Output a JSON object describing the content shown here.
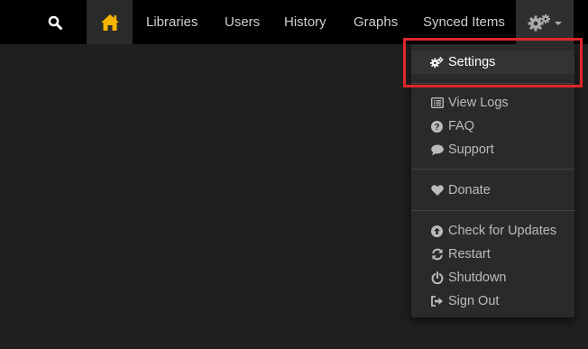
{
  "nav": {
    "search_icon": "search-icon",
    "home_icon": "home-icon",
    "links": [
      "Libraries",
      "Users",
      "History",
      "Graphs",
      "Synced Items"
    ],
    "settings_icon": "cogs-icon",
    "home_color": "#f5b400"
  },
  "menu": {
    "settings": "Settings",
    "view_logs": "View Logs",
    "faq": "FAQ",
    "support": "Support",
    "donate": "Donate",
    "check_updates": "Check for Updates",
    "restart": "Restart",
    "shutdown": "Shutdown",
    "sign_out": "Sign Out"
  },
  "highlight_color": "#e0262b"
}
